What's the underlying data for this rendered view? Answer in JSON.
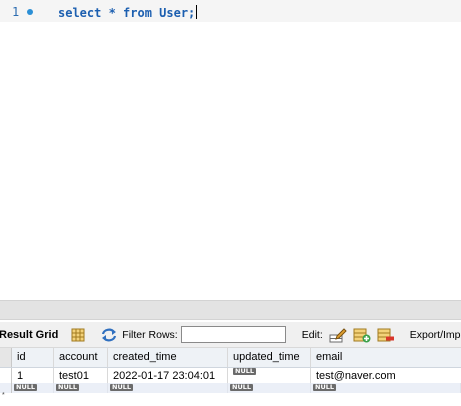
{
  "editor": {
    "line_number": "1",
    "query": "select * from User;"
  },
  "result_toolbar": {
    "title": "Result Grid",
    "filter_label": "Filter Rows:",
    "filter_value": "",
    "edit_label": "Edit:",
    "export_label": "Export/Impor",
    "icons": [
      "grid-view-icon",
      "refresh-icon",
      "edit-row-icon",
      "add-row-icon",
      "delete-row-icon"
    ]
  },
  "grid": {
    "columns": [
      "id",
      "account",
      "created_time",
      "updated_time",
      "email"
    ],
    "rows": [
      {
        "id": "1",
        "account": "test01",
        "created_time": "2022-01-17 23:04:01",
        "updated_time": "NULL",
        "email": "test@naver.com"
      }
    ],
    "new_row": [
      "NULL",
      "NULL",
      "NULL",
      "NULL",
      "NULL"
    ],
    "null_text": "NULL",
    "row_marker": "*"
  },
  "colors": {
    "keyword": "#1c5fb0",
    "null_badge": "#6b6b6b",
    "toolbar_bg": "#f0f0f0",
    "splitter_bg": "#e3e3e3"
  }
}
